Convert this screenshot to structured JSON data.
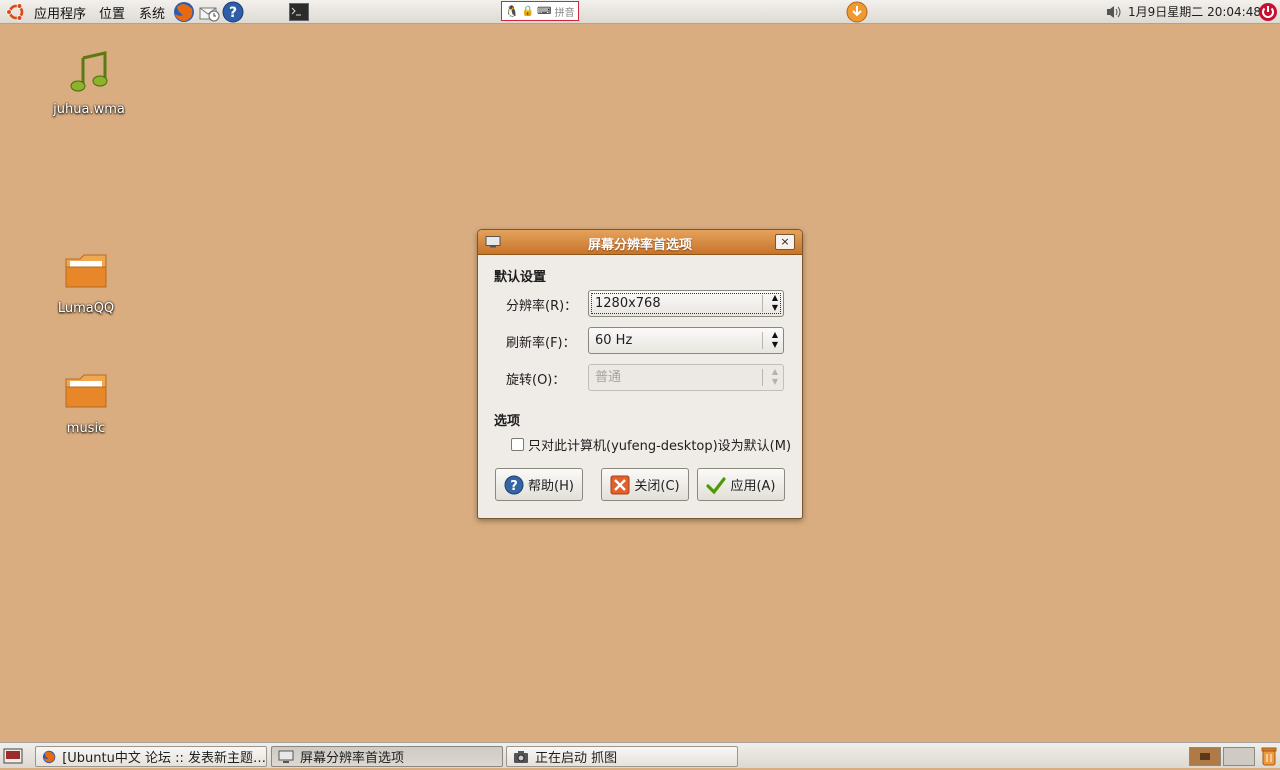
{
  "top_panel": {
    "menus": [
      "应用程序",
      "位置",
      "系统"
    ],
    "ime_label": "拼音",
    "clock": "1月9日星期二 20:04:48"
  },
  "desktop": {
    "icons": [
      {
        "label": "juhua.wma",
        "icon": "music-file-icon"
      },
      {
        "label": "LumaQQ",
        "icon": "folder-icon"
      },
      {
        "label": "music",
        "icon": "folder-icon"
      }
    ]
  },
  "dialog": {
    "title": "屏幕分辨率首选项",
    "close_glyph": "×",
    "section_default": "默认设置",
    "resolution": {
      "label": "分辨率(R)：",
      "value": "1280x768"
    },
    "refresh": {
      "label": "刷新率(F)：",
      "value": "60 Hz"
    },
    "rotation": {
      "label": "旋转(O)：",
      "value": "普通"
    },
    "section_options": "选项",
    "checkbox": {
      "label": "只对此计算机(yufeng-desktop)设为默认(M)",
      "checked": false
    },
    "buttons": {
      "help": "帮助(H)",
      "close": "关闭(C)",
      "apply": "应用(A)"
    }
  },
  "taskbar": {
    "tasks": [
      {
        "label": "[Ubuntu中文 论坛 :: 发表新主题…",
        "icon": "firefox-icon",
        "active": false
      },
      {
        "label": "屏幕分辨率首选项",
        "icon": "monitor-icon",
        "active": true
      },
      {
        "label": "正在启动 抓图",
        "icon": "camera-icon",
        "active": false
      }
    ]
  },
  "colors": {
    "desktop": "#d9ad80",
    "titlebar": "#c8742a",
    "accent": "#e07b1f"
  }
}
